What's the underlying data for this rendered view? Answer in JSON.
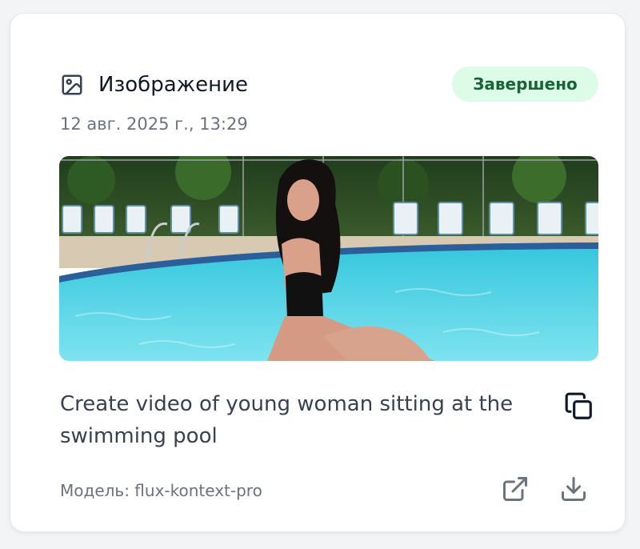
{
  "card": {
    "type_icon": "image-icon",
    "title": "Изображение",
    "status": "Завершено",
    "status_color": "#166534",
    "status_bg": "#dcfce7",
    "date": "12 авг. 2025 г., 13:29",
    "prompt": "Create video of young woman sitting at the swimming pool",
    "model": "Модель: flux-kontext-pro",
    "actions": [
      "copy-icon",
      "open-external-icon",
      "download-icon"
    ]
  }
}
